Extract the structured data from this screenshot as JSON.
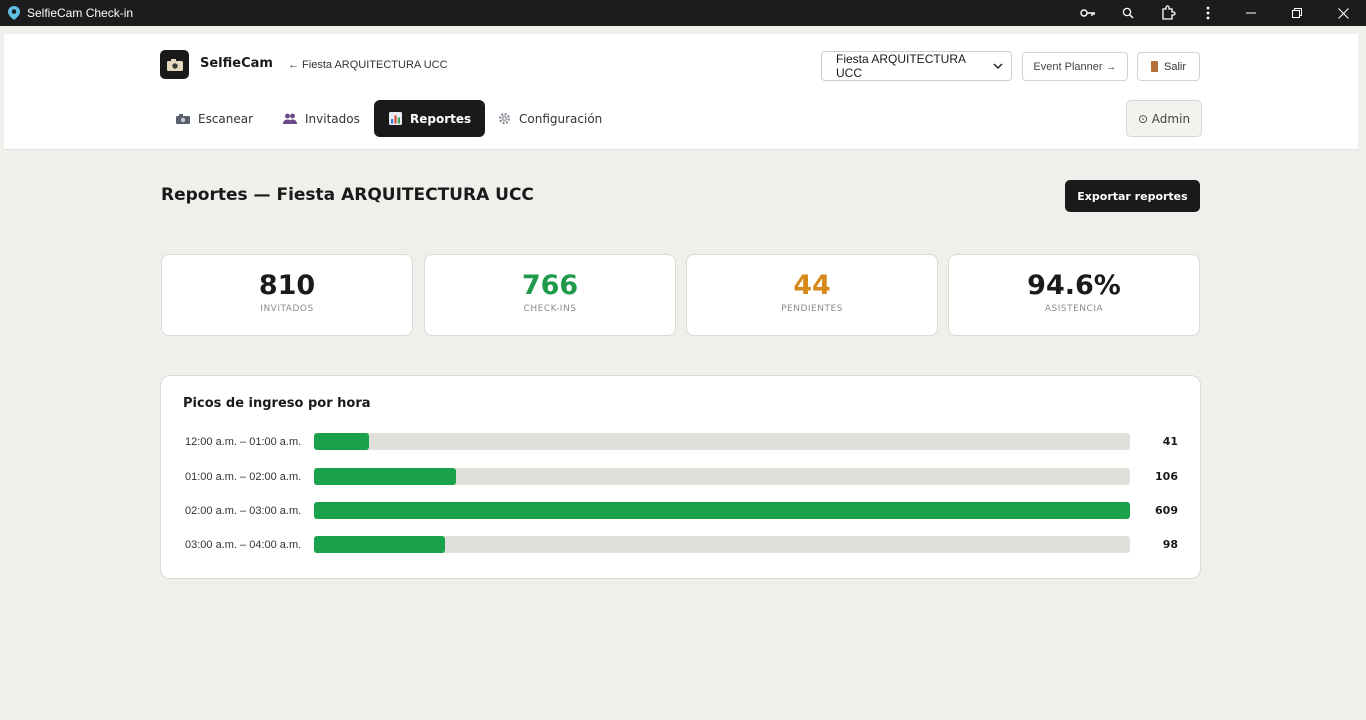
{
  "window": {
    "title": "SelfieCam Check-in"
  },
  "header": {
    "brand": "SelfieCam",
    "back_link": "← Fiesta ARQUITECTURA UCC",
    "event_select": "Fiesta ARQUITECTURA UCC",
    "planner_label": "Event Planner →",
    "logout_label": "Salir",
    "admin_label": "⊙ Admin",
    "tabs": [
      {
        "label": "Escanear",
        "icon": "camera-icon"
      },
      {
        "label": "Invitados",
        "icon": "users-icon"
      },
      {
        "label": "Reportes",
        "icon": "chart-icon",
        "active": true
      },
      {
        "label": "Configuración",
        "icon": "gear-icon"
      }
    ]
  },
  "main": {
    "title": "Reportes — Fiesta ARQUITECTURA UCC",
    "export_label": "Exportar reportes",
    "stats": [
      {
        "value": "810",
        "label": "INVITADOS",
        "color": "#1a1a1a"
      },
      {
        "value": "766",
        "label": "CHECK-INS",
        "color": "#1f9a4a"
      },
      {
        "value": "44",
        "label": "PENDIENTES",
        "color": "#d68a1c"
      },
      {
        "value": "94.6%",
        "label": "ASISTENCIA",
        "color": "#1a1a1a"
      }
    ]
  },
  "chart_data": {
    "type": "bar",
    "title": "Picos de ingreso por hora",
    "categories": [
      "12:00 a.m. – 01:00 a.m.",
      "01:00 a.m. – 02:00 a.m.",
      "02:00 a.m. – 03:00 a.m.",
      "03:00 a.m. – 04:00 a.m."
    ],
    "values": [
      41,
      106,
      609,
      98
    ],
    "max": 609,
    "bar_color": "#19a24b",
    "track_color": "#e1dfd9"
  }
}
